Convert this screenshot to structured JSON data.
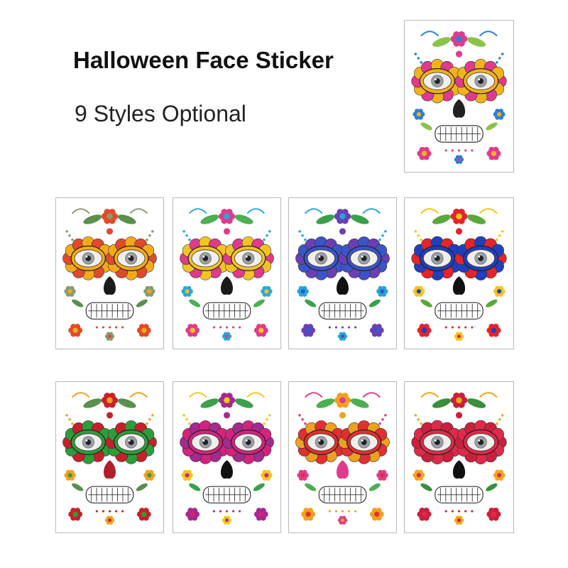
{
  "header": {
    "title": "Halloween Face Sticker",
    "subtitle": "9 Styles Optional"
  },
  "stickers": [
    {
      "style": "blue-pink sugar skull",
      "eye": "#f2b21c",
      "accent": "#e03a8c",
      "accent2": "#2b7fd6",
      "leaf": "#8bc34a",
      "nose": "#222222"
    },
    {
      "style": "sunflower skull",
      "eye": "#f5a91a",
      "accent": "#e04a2a",
      "accent2": "#8a9a70",
      "leaf": "#5a8f4e",
      "nose": "#1a1a1a"
    },
    {
      "style": "diamond heart skull",
      "eye": "#f3c325",
      "accent": "#e03a8c",
      "accent2": "#29a8d8",
      "leaf": "#4caf50",
      "nose": "#1a1a1a"
    },
    {
      "style": "blue diamond skull",
      "eye": "#3b55c8",
      "accent": "#6a3fb5",
      "accent2": "#24a5d8",
      "leaf": "#3aa04a",
      "nose": "#111111"
    },
    {
      "style": "star skull",
      "eye": "#1f3fbf",
      "accent": "#e6232b",
      "accent2": "#f4c51c",
      "leaf": "#5aa83a",
      "nose": "#111111"
    },
    {
      "style": "green leaf skull",
      "eye": "#2f9c3a",
      "accent": "#c8202a",
      "accent2": "#f0a020",
      "leaf": "#5a8f4e",
      "nose": "#b0202a"
    },
    {
      "style": "magenta diamond skull",
      "eye": "#d3237e",
      "accent": "#a32a8f",
      "accent2": "#f4c51c",
      "leaf": "#3aa04a",
      "nose": "#111111"
    },
    {
      "style": "spider web skull",
      "eye": "#e03030",
      "accent": "#f0a020",
      "accent2": "#e03a8c",
      "leaf": "#4caf50",
      "nose": "#e03a8c"
    },
    {
      "style": "rose skull",
      "eye": "#e02a4a",
      "accent": "#c9203c",
      "accent2": "#f4a51c",
      "leaf": "#3a8f3a",
      "nose": "#111111"
    }
  ]
}
